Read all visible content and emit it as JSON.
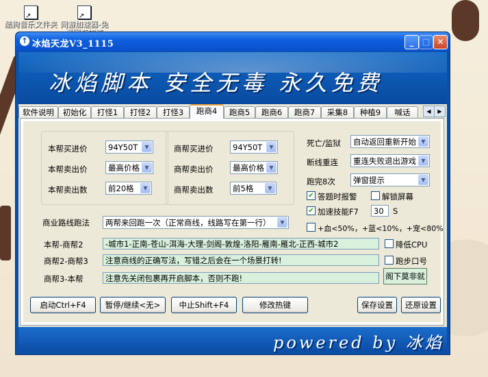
{
  "desktop": {
    "icons": [
      {
        "label": "酷狗音乐文件夹"
      },
      {
        "label": "网游加速器-免费网游加速"
      }
    ]
  },
  "window": {
    "title": "冰焰天龙V3_1115",
    "banner": "冰焰脚本  安全无毒  永久免费",
    "footer": "powered by 冰焰",
    "buttons": {
      "minimize": "_",
      "maximize": "□",
      "close": "✕"
    }
  },
  "tabs": [
    {
      "label": "软件说明"
    },
    {
      "label": "初始化"
    },
    {
      "label": "打怪1"
    },
    {
      "label": "打怪2"
    },
    {
      "label": "打怪3"
    },
    {
      "label": "跑商4",
      "active": true
    },
    {
      "label": "跑商5"
    },
    {
      "label": "跑商6"
    },
    {
      "label": "跑商7"
    },
    {
      "label": "采集8"
    },
    {
      "label": "种植9"
    },
    {
      "label": "喊话"
    }
  ],
  "group_left": {
    "buy_label": "本帮买进价",
    "buy_value": "94Y50T",
    "sell_label": "本帮卖出价",
    "sell_value": "最高价格",
    "count_label": "本帮卖出数",
    "count_value": "前20格"
  },
  "group_mid": {
    "buy_label": "商帮买进价",
    "buy_value": "94Y50T",
    "sell_label": "商帮卖出价",
    "sell_value": "最高价格",
    "count_label": "商帮卖出数",
    "count_value": "前5格"
  },
  "right": {
    "death_label": "死亡/监狱",
    "death_value": "自动返回重新开始",
    "disconnect_label": "断线重连",
    "disconnect_value": "重连失败退出游戏",
    "run_label": "跑完8次",
    "run_value": "弹窗提示",
    "answer_alarm": {
      "label": "答题时报警",
      "checked": true
    },
    "unlock_screen": {
      "label": "解锁屏幕",
      "checked": false
    },
    "speed_skill": {
      "label": "加速技能F7",
      "checked": true
    },
    "speed_value": "30",
    "speed_unit": "S",
    "heal_line": {
      "label": "+血<50%，+蓝<10%，+宠<80%",
      "checked": false
    },
    "low_cpu": {
      "label": "降低CPU",
      "checked": false
    },
    "run_password": {
      "label": "跑步口号",
      "checked": false
    },
    "hint_button": "阁下莫非就"
  },
  "routes": {
    "method_label": "商业路线跑法",
    "method_value": "两帮来回跑一次（正常商线，线路写在第一行）",
    "r1_label": "本帮-商帮2",
    "r1_value": "-城市1-正南-苍山-洱海-大理-剑阁-敦煌-洛阳-雁南-雁北-正西-城市2",
    "r2_label": "商帮2-商帮3",
    "r2_value": "注意商线的正确写法，写错之后会在一个场景打转!",
    "r3_label": "商帮3-本帮",
    "r3_value": "注意先关闭包裹再开启脚本，否则不跑!"
  },
  "actions": {
    "start": "启动Ctrl+F4",
    "pause": "暂停/继续<无>",
    "stop": "中止Shift+F4",
    "hotkey": "修改热键",
    "save": "保存设置",
    "restore": "还原设置"
  }
}
